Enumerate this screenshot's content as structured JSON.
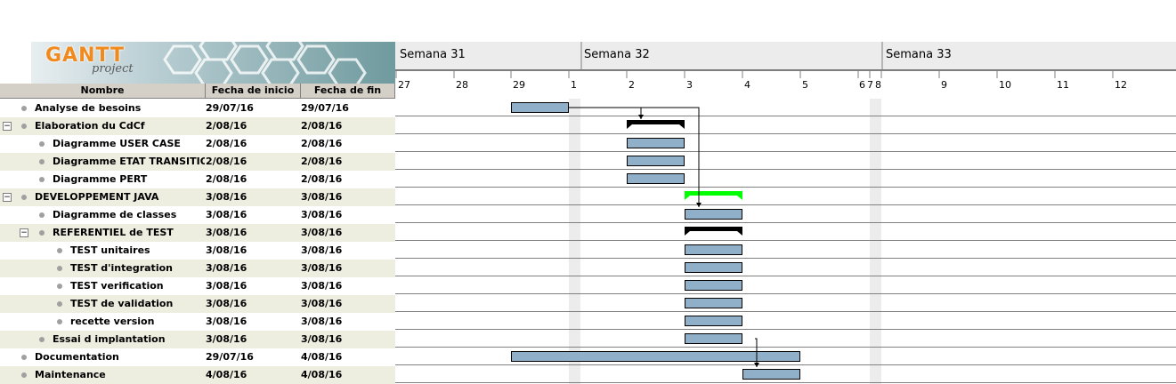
{
  "logo": {
    "brand": "GANTT",
    "sub": "project"
  },
  "columns": {
    "name": "Nombre",
    "start": "Fecha de inicio",
    "end": "Fecha de fin"
  },
  "weeks": [
    "Semana 31",
    "Semana 32",
    "Semana 33"
  ],
  "days": [
    "27",
    "28",
    "29",
    "1",
    "2",
    "3",
    "4",
    "5",
    "6",
    "7",
    "8",
    "9",
    "10",
    "11",
    "12"
  ],
  "tasks": [
    {
      "name": "Analyse de besoins",
      "start": "29/07/16",
      "end": "29/07/16"
    },
    {
      "name": "Elaboration du CdCf",
      "start": "2/08/16",
      "end": "2/08/16"
    },
    {
      "name": "Diagramme USER CASE",
      "start": "2/08/16",
      "end": "2/08/16"
    },
    {
      "name": "Diagramme ETAT TRANSITION",
      "start": "2/08/16",
      "end": "2/08/16"
    },
    {
      "name": "Diagramme PERT",
      "start": "2/08/16",
      "end": "2/08/16"
    },
    {
      "name": "DEVELOPPEMENT JAVA",
      "start": "3/08/16",
      "end": "3/08/16"
    },
    {
      "name": "Diagramme de classes",
      "start": "3/08/16",
      "end": "3/08/16"
    },
    {
      "name": "REFERENTIEL de TEST",
      "start": "3/08/16",
      "end": "3/08/16"
    },
    {
      "name": "TEST unitaires",
      "start": "3/08/16",
      "end": "3/08/16"
    },
    {
      "name": "TEST d'integration",
      "start": "3/08/16",
      "end": "3/08/16"
    },
    {
      "name": "TEST verification",
      "start": "3/08/16",
      "end": "3/08/16"
    },
    {
      "name": "TEST de validation",
      "start": "3/08/16",
      "end": "3/08/16"
    },
    {
      "name": "recette version",
      "start": "3/08/16",
      "end": "3/08/16"
    },
    {
      "name": "Essai d implantation",
      "start": "3/08/16",
      "end": "3/08/16"
    },
    {
      "name": "Documentation",
      "start": "29/07/16",
      "end": "4/08/16"
    },
    {
      "name": "Maintenance",
      "start": "4/08/16",
      "end": "4/08/16"
    }
  ],
  "colors": {
    "bar": "#8fb0c8",
    "summary": "#000000",
    "summary_highlight": "#00ff00",
    "alt_row": "#eeeee0"
  }
}
